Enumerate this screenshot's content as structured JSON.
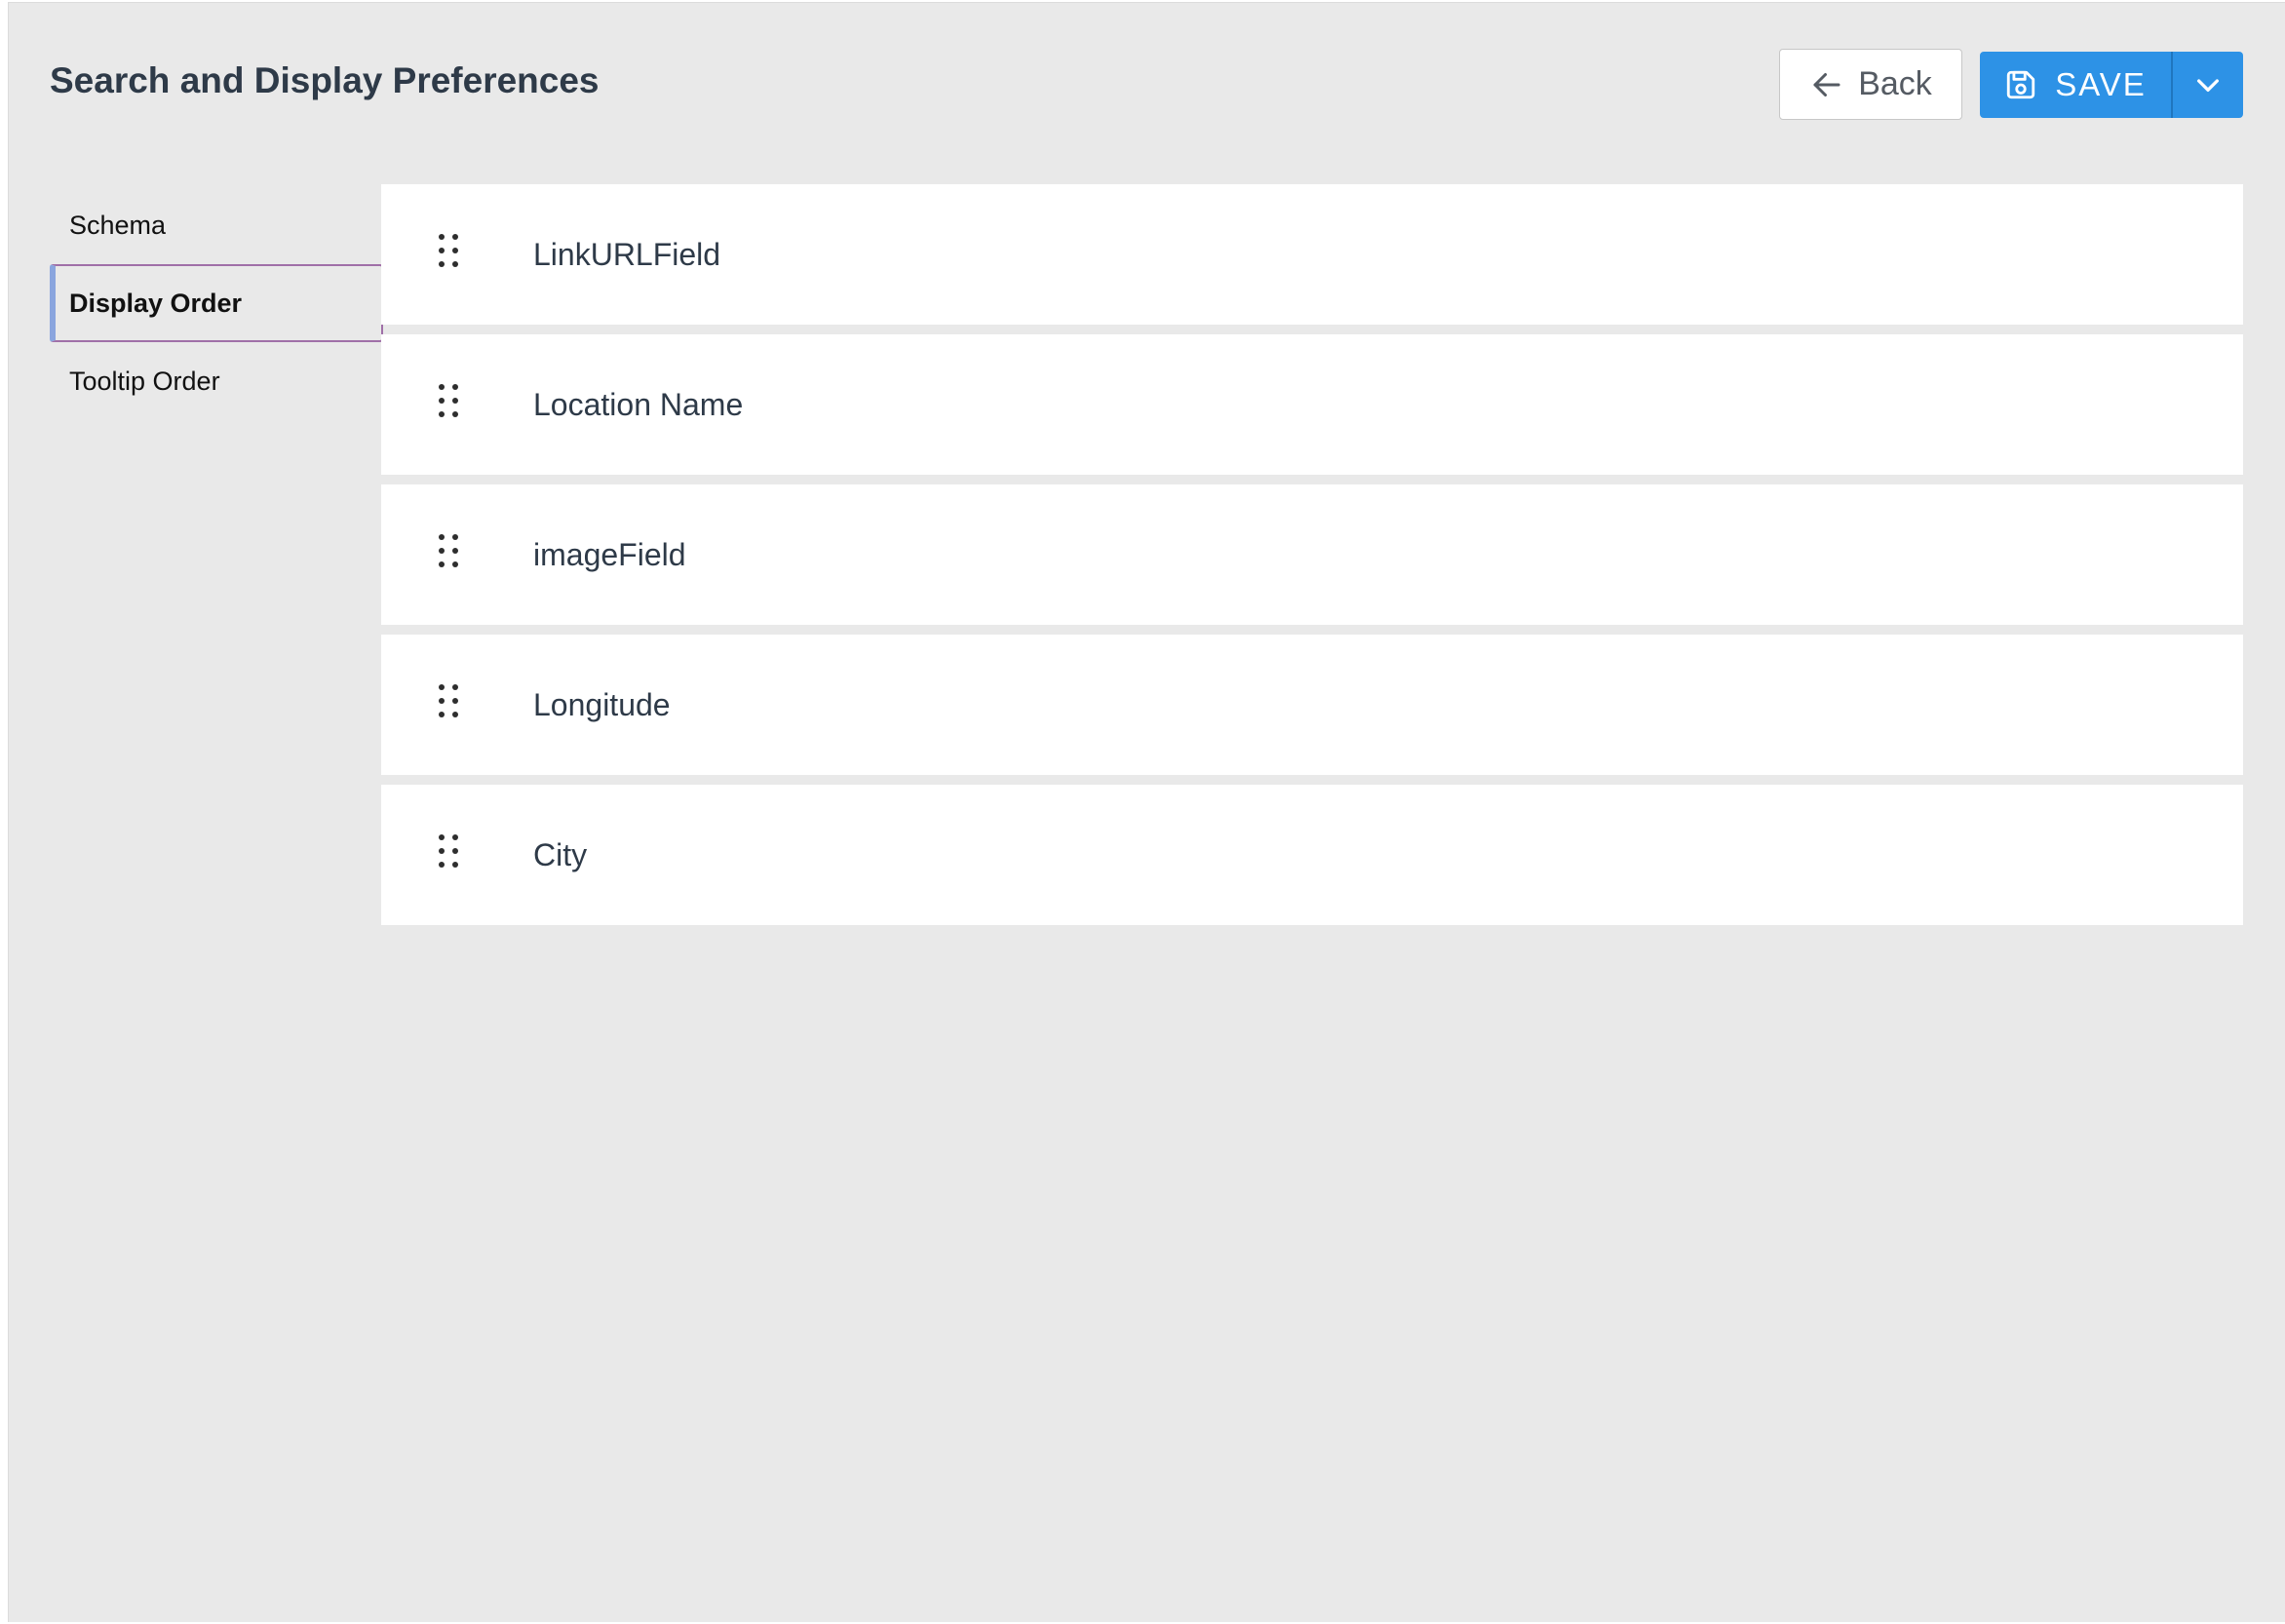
{
  "header": {
    "title": "Search and Display Preferences",
    "back_label": "Back",
    "back_icon": "arrow-left-icon",
    "save_label": "SAVE",
    "save_icon": "floppy-disk-icon",
    "dropdown_icon": "chevron-down-icon"
  },
  "sidenav": {
    "items": [
      {
        "label": "Schema",
        "active": false
      },
      {
        "label": "Display Order",
        "active": true
      },
      {
        "label": "Tooltip Order",
        "active": false
      }
    ]
  },
  "fields": [
    {
      "label": "LinkURLField"
    },
    {
      "label": "Location Name"
    },
    {
      "label": "imageField"
    },
    {
      "label": "Longitude"
    },
    {
      "label": "City"
    }
  ],
  "colors": {
    "background": "#e9e9e9",
    "primary": "#2d92e6",
    "title_text": "#2e3a48",
    "active_border": "#a070a8"
  }
}
